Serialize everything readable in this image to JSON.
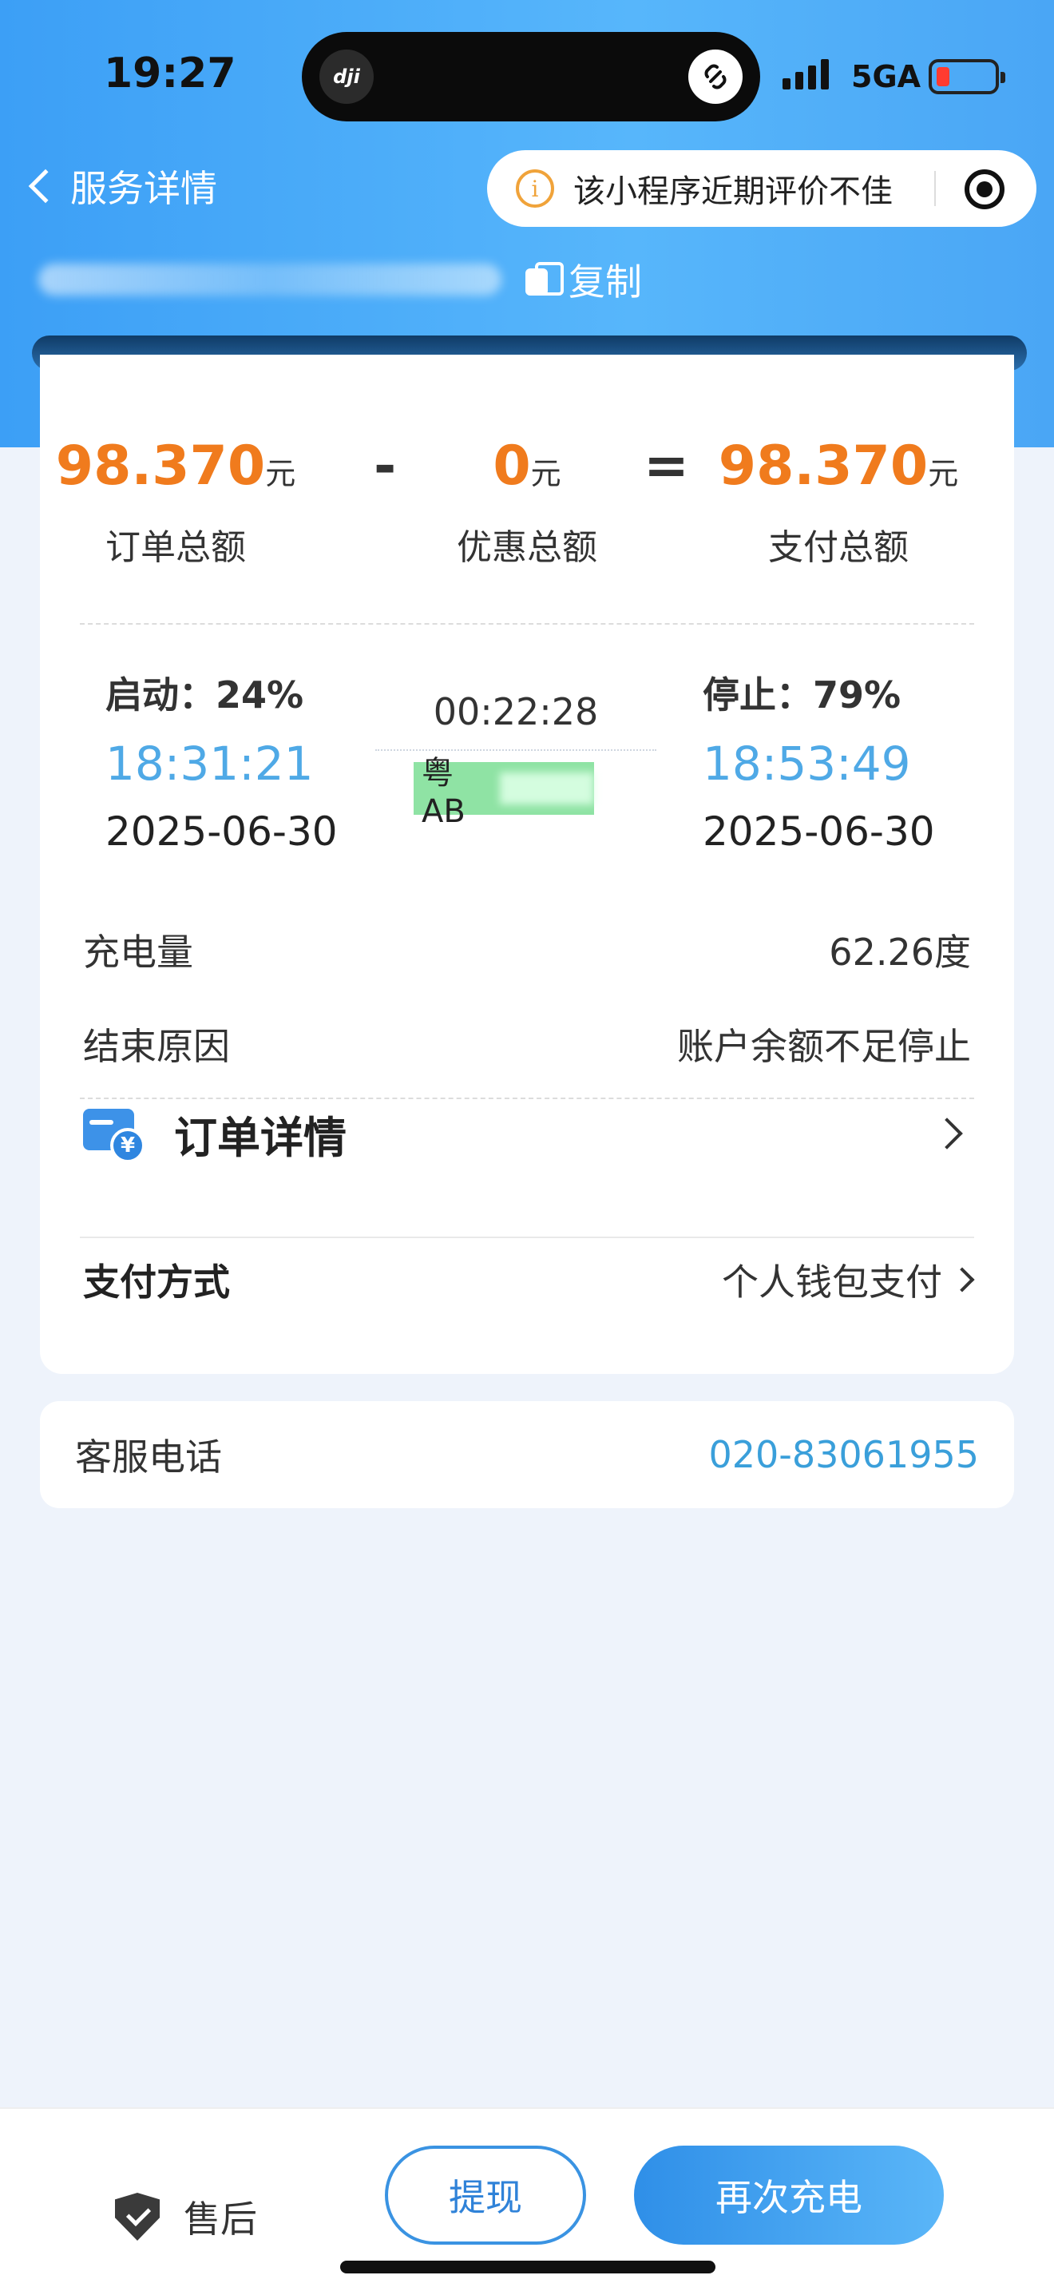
{
  "status_bar": {
    "time": "19:27",
    "network": "5GA",
    "island_left": "dji"
  },
  "nav": {
    "back_label": "服务详情",
    "capsule_text": "该小程序近期评价不佳"
  },
  "order": {
    "copy_label": "复制"
  },
  "totals": {
    "order_total": "98.370",
    "order_total_label": "订单总额",
    "discount_total": "0",
    "discount_total_label": "优惠总额",
    "pay_total": "98.370",
    "pay_total_label": "支付总额",
    "unit": "元",
    "minus": "-",
    "equals": "="
  },
  "session": {
    "start_label": "启动：24%",
    "start_time": "18:31:21",
    "start_date": "2025-06-30",
    "duration": "00:22:28",
    "plate_prefix": "粤AB",
    "stop_label": "停止：79%",
    "stop_time": "18:53:49",
    "stop_date": "2025-06-30"
  },
  "details": {
    "charge_label": "充电量",
    "charge_value": "62.26度",
    "end_reason_label": "结束原因",
    "end_reason_value": "账户余额不足停止",
    "order_detail_label": "订单详情",
    "payment_label": "支付方式",
    "payment_value": "个人钱包支付"
  },
  "service": {
    "label": "客服电话",
    "phone": "020-83061955"
  },
  "bottom": {
    "after_sale": "售后",
    "withdraw": "提现",
    "recharge": "再次充电"
  },
  "colors": {
    "accent_orange": "#f07b1d",
    "accent_blue": "#4fa9e6",
    "brand_blue": "#3c9ff6"
  }
}
